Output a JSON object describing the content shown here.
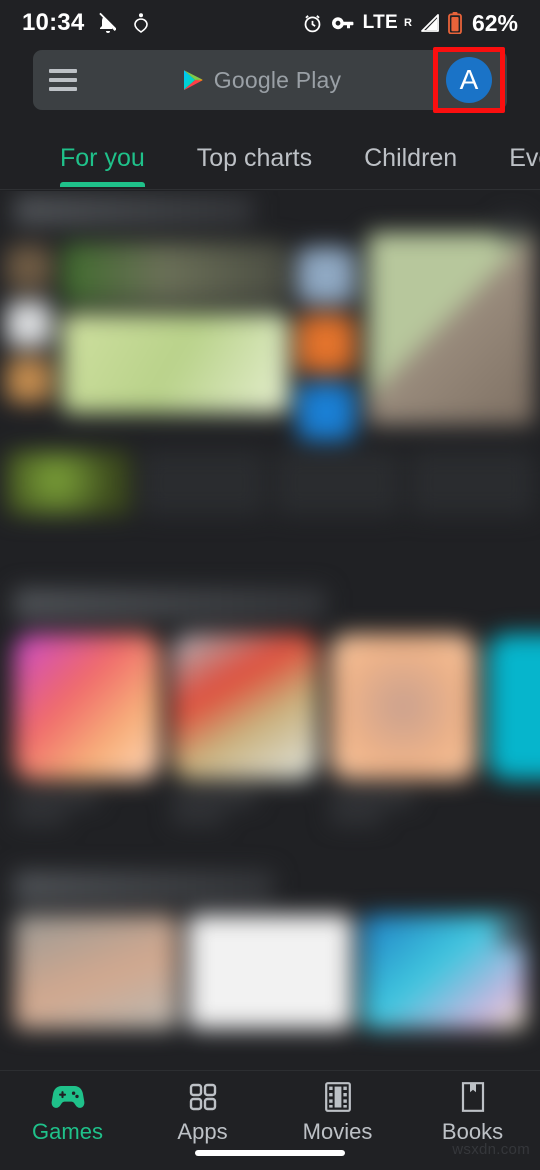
{
  "status_bar": {
    "time": "10:34",
    "icons_left": [
      "notifications-off-icon",
      "body-sensor-icon"
    ],
    "alarm_icon": "alarm-clock-icon",
    "vpn_icon": "vpn-key-icon",
    "network_label": "LTE",
    "roaming_label": "R",
    "signal_icon": "signal-bars-icon",
    "battery_icon": "battery-low-icon",
    "battery_percent": "62%"
  },
  "search_bar": {
    "menu_icon": "hamburger-menu-icon",
    "brand_icon": "google-play-logo",
    "placeholder": "Google Play",
    "avatar_initial": "A",
    "avatar_color": "#1a73c7",
    "highlight_color": "#fa0f0f"
  },
  "tabs": [
    {
      "label": "For you",
      "active": true
    },
    {
      "label": "Top charts",
      "active": false
    },
    {
      "label": "Children",
      "active": false
    },
    {
      "label": "Even",
      "active": false
    }
  ],
  "bottom_nav": [
    {
      "label": "Games",
      "icon": "gamepad-icon",
      "active": true
    },
    {
      "label": "Apps",
      "icon": "apps-grid-icon",
      "active": false
    },
    {
      "label": "Movies",
      "icon": "film-strip-icon",
      "active": false
    },
    {
      "label": "Books",
      "icon": "book-bookmark-icon",
      "active": false
    }
  ],
  "colors": {
    "background": "#202124",
    "surface": "#3c4043",
    "accent": "#1fc18a",
    "text_secondary": "#bdc1c6"
  },
  "watermark": "wsxdn.com"
}
